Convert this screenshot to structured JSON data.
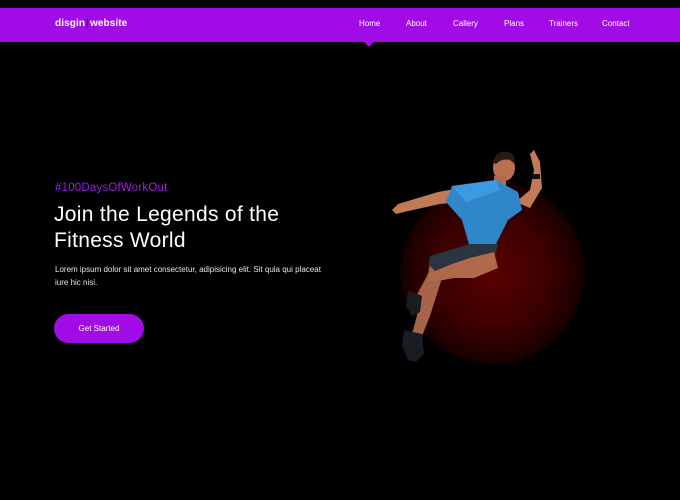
{
  "brand": {
    "name_left": "disgin",
    "separator": "|",
    "name_right": "website"
  },
  "nav": {
    "items": [
      "Home",
      "About",
      "Callery",
      "Plans",
      "Trainers",
      "Contact"
    ],
    "active": "Home"
  },
  "hero": {
    "tag": "#100DaysOfWorkOut",
    "title": "Join the Legends of the Fitness World",
    "description": "Lorem ipsum dolor sit amet consectetur, adipisicing elit. Sit quia qui placeat iure hic nisi.",
    "cta_label": "Get Started"
  },
  "colors": {
    "accent": "#a10ce6",
    "tag": "#a21cf0",
    "background": "#000000"
  },
  "icons": {
    "athlete": "running-athlete-image"
  }
}
